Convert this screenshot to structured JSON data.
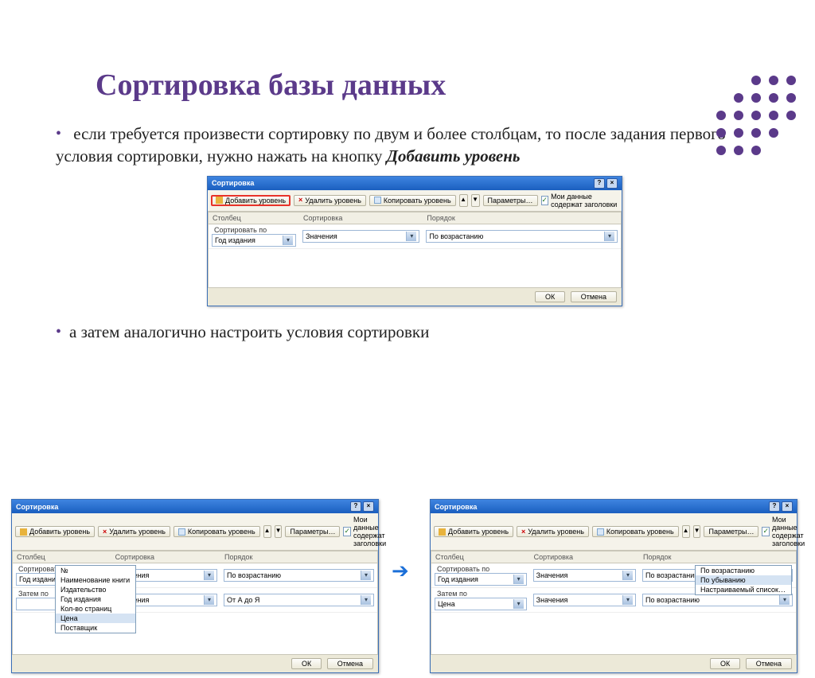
{
  "title": "Сортировка базы данных",
  "bullet1_pre": "если требуется произвести сортировку по двум и более столбцам, то после задания первого условия сортировки, нужно нажать на кнопку ",
  "bullet1_bold": "Добавить уровень",
  "bullet2": "а затем аналогично настроить условия сортировки",
  "dialog": {
    "title": "Сортировка",
    "add": "Добавить уровень",
    "del": "Удалить уровень",
    "copy": "Копировать уровень",
    "opts": "Параметры…",
    "headers_chk": "Мои данные содержат заголовки",
    "col_column": "Столбец",
    "col_sort": "Сортировка",
    "col_order": "Порядок",
    "row_sortby": "Сортировать по",
    "row_thenby": "Затем по",
    "val_year": "Год издания",
    "val_values": "Значения",
    "val_asc": "По возрастанию",
    "val_atoZ": "От А до Я",
    "val_price": "Цена",
    "val_desc": "По убыванию",
    "ok": "ОК",
    "cancel": "Отмена"
  },
  "dropdown_fields": [
    "№",
    "Наименование книги",
    "Издательство",
    "Год издания",
    "Кол-во страниц",
    "Цена",
    "Поставщик"
  ],
  "dropdown_order": [
    "По возрастанию",
    "По убыванию",
    "Настраиваемый список…"
  ]
}
